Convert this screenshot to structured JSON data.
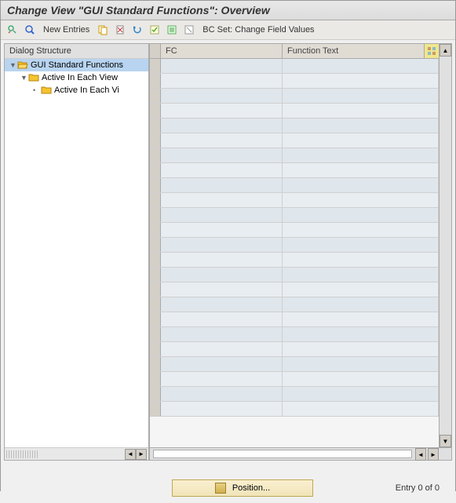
{
  "title": "Change View \"GUI Standard Functions\": Overview",
  "toolbar": {
    "new_entries": "New Entries",
    "bc_set": "BC Set: Change Field Values"
  },
  "sidebar": {
    "header": "Dialog Structure",
    "items": [
      {
        "label": "GUI Standard Functions",
        "level": 0,
        "expanded": true,
        "selected": true,
        "icon": "folder-open"
      },
      {
        "label": "Active In Each View",
        "level": 1,
        "expanded": true,
        "selected": false,
        "icon": "folder-closed"
      },
      {
        "label": "Active In Each Vi",
        "level": 2,
        "expanded": false,
        "selected": false,
        "icon": "folder-closed"
      }
    ]
  },
  "table": {
    "columns": {
      "fc": "FC",
      "function_text": "Function Text"
    },
    "row_count": 24
  },
  "footer": {
    "position_label": "Position...",
    "entry_label": "Entry 0 of 0"
  }
}
